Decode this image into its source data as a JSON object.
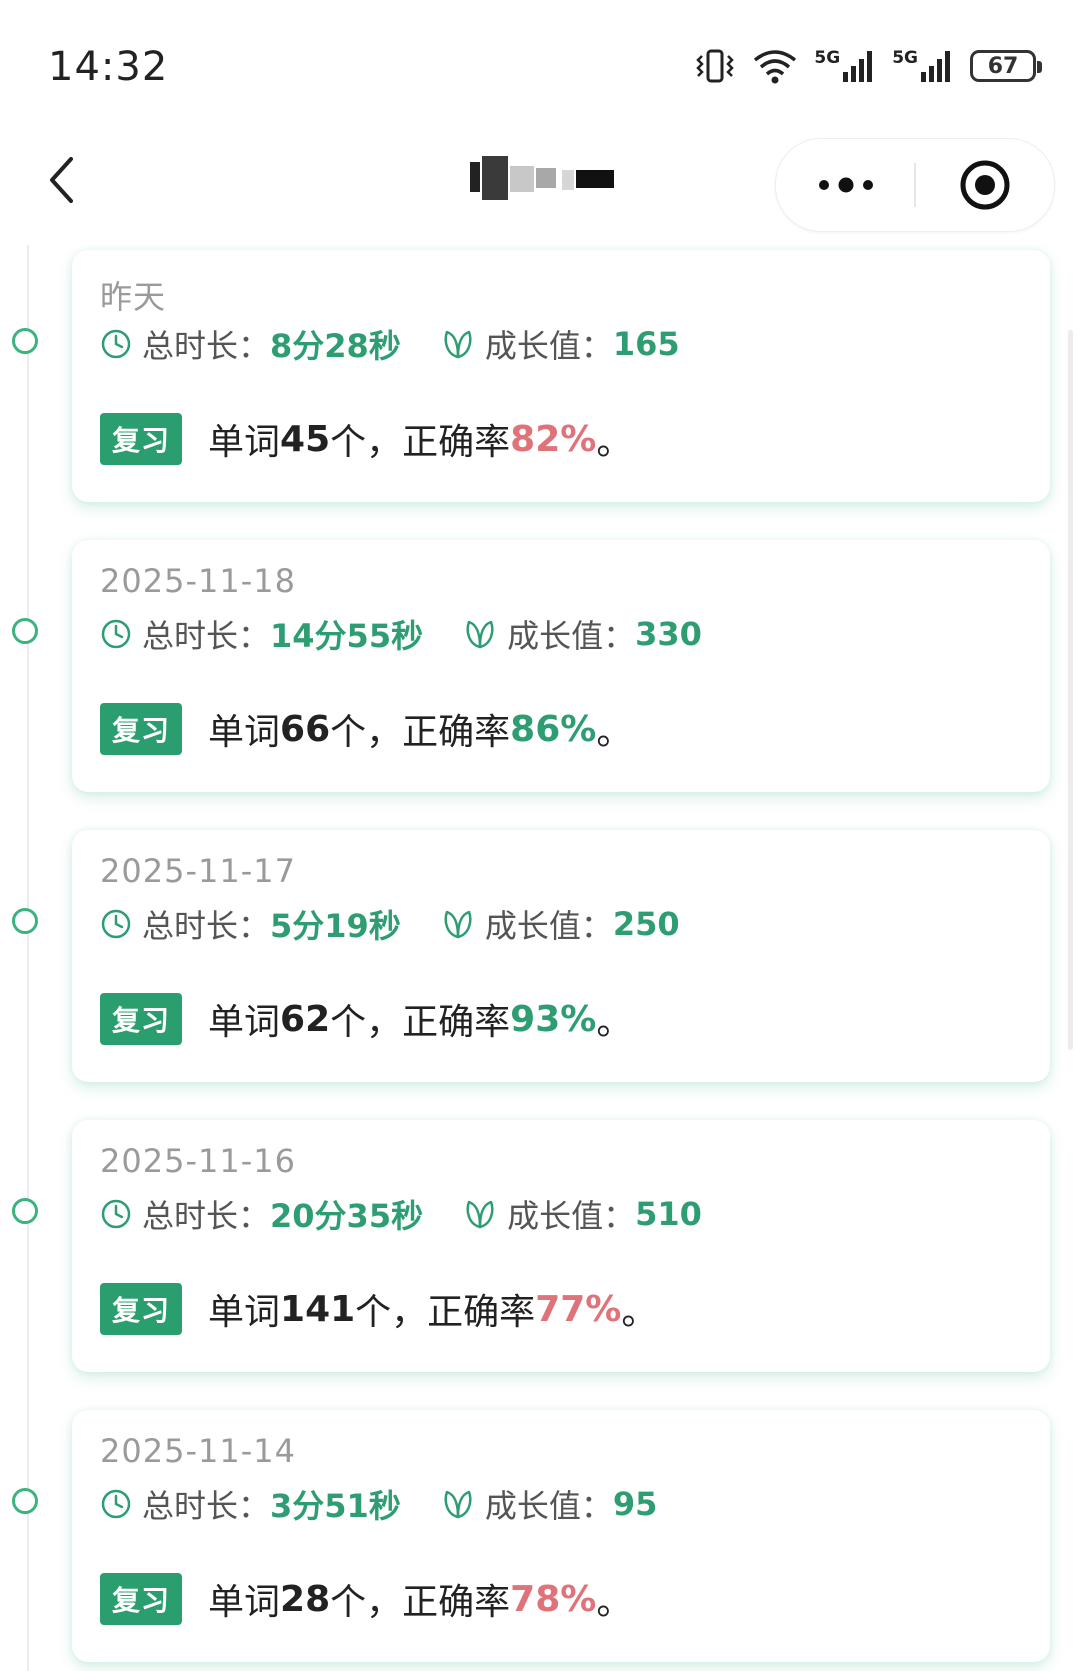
{
  "status_bar": {
    "time": "14:32",
    "network_1": "5G",
    "network_2": "5G",
    "battery": "67",
    "icons": [
      "vibrate-icon",
      "wifi-icon",
      "signal-icon",
      "signal-icon",
      "battery-icon"
    ]
  },
  "nav": {
    "back_icon": "chevron-left-icon",
    "more_icon": "more-dots-icon",
    "close_icon": "target-close-icon"
  },
  "colors": {
    "accent": "#2a9e6e",
    "good_rate": "#2e9e72",
    "low_rate": "#e0727a"
  },
  "labels": {
    "duration": "总时长：",
    "growth": "成长值：",
    "tag": "复习",
    "word_prefix": "单词",
    "word_suffix": "个，正确率",
    "end": "。"
  },
  "records": [
    {
      "date": "昨天",
      "duration": "8分28秒",
      "growth": "165",
      "words": "45",
      "rate": "82%",
      "rate_status": "low"
    },
    {
      "date": "2025-11-18",
      "duration": "14分55秒",
      "growth": "330",
      "words": "66",
      "rate": "86%",
      "rate_status": "good"
    },
    {
      "date": "2025-11-17",
      "duration": "5分19秒",
      "growth": "250",
      "words": "62",
      "rate": "93%",
      "rate_status": "good"
    },
    {
      "date": "2025-11-16",
      "duration": "20分35秒",
      "growth": "510",
      "words": "141",
      "rate": "77%",
      "rate_status": "low"
    },
    {
      "date": "2025-11-14",
      "duration": "3分51秒",
      "growth": "95",
      "words": "28",
      "rate": "78%",
      "rate_status": "low"
    }
  ]
}
